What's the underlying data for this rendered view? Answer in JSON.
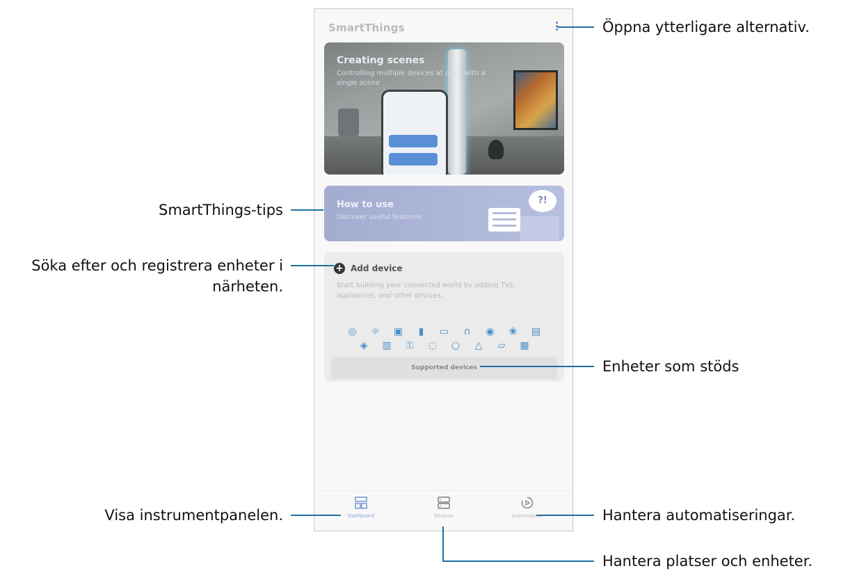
{
  "app": {
    "title": "SmartThings"
  },
  "hero": {
    "title": "Creating scenes",
    "subtitle": "Controlling multiple devices at once with a single scene"
  },
  "tips": {
    "title": "How to use",
    "subtitle": "Discover useful features",
    "bubble_text": "?!"
  },
  "add_device": {
    "plus": "+",
    "title": "Add device",
    "description": "Start building your connected world by adding TVs, appliances, and other devices.",
    "supported_button": "Supported devices"
  },
  "bottom_nav": [
    {
      "label": "Dashboard"
    },
    {
      "label": "Devices"
    },
    {
      "label": "Automations"
    }
  ],
  "callouts": {
    "options": "Öppna ytterligare alternativ.",
    "tips": "SmartThings-tips",
    "add_line1": "Söka efter och registrera enheter i",
    "add_line2": "närheten.",
    "supported": "Enheter som stöds",
    "dashboard": "Visa instrumentpanelen.",
    "automations": "Hantera automatiseringar.",
    "devices": "Hantera platser och enheter."
  },
  "colors": {
    "callout_line": "#1f6fa5",
    "accent": "#5d7fc9"
  }
}
